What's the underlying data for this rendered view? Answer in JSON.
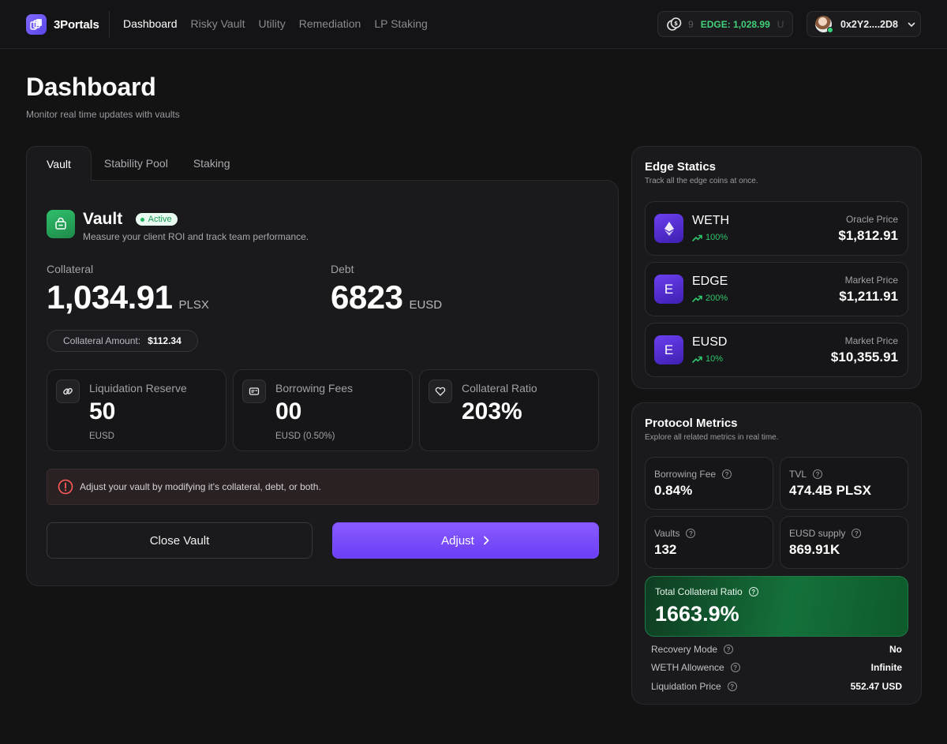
{
  "app": {
    "name": "3Portals"
  },
  "nav": {
    "items": [
      {
        "label": "Dashboard",
        "active": true
      },
      {
        "label": "Risky Vault",
        "active": false
      },
      {
        "label": "Utility",
        "active": false
      },
      {
        "label": "Remediation",
        "active": false
      },
      {
        "label": "LP Staking",
        "active": false
      }
    ]
  },
  "ticker": {
    "prefix": "9",
    "value": "EDGE: 1,028.99",
    "suffix": "U"
  },
  "wallet": {
    "address": "0x2Y2....2D8"
  },
  "page": {
    "title": "Dashboard",
    "subtitle": "Monitor real time updates with vaults"
  },
  "tabs": [
    {
      "label": "Vault",
      "active": true
    },
    {
      "label": "Stability Pool",
      "active": false
    },
    {
      "label": "Staking",
      "active": false
    }
  ],
  "vault": {
    "title": "Vault",
    "status": "Active",
    "description": "Measure your client ROI and track team performance.",
    "collateral": {
      "label": "Collateral",
      "value": "1,034.91",
      "unit": "PLSX"
    },
    "debt": {
      "label": "Debt",
      "value": "6823",
      "unit": "EUSD"
    },
    "collateral_amount": {
      "label": "Collateral Amount:",
      "value": "$112.34"
    },
    "cards": [
      {
        "label": "Liquidation Reserve",
        "value": "50",
        "sub": "EUSD",
        "icon": "link-icon"
      },
      {
        "label": "Borrowing Fees",
        "value": "00",
        "sub": "EUSD (0.50%)",
        "icon": "receipt-icon"
      },
      {
        "label": "Collateral Ratio",
        "value": "203%",
        "sub": "",
        "icon": "heart-icon"
      }
    ],
    "alert": "Adjust your vault by modifying it's collateral, debt, or both.",
    "close_label": "Close Vault",
    "adjust_label": "Adjust"
  },
  "edge_statics": {
    "title": "Edge Statics",
    "subtitle": "Track all the edge coins at once.",
    "coins": [
      {
        "name": "WETH",
        "change": "100%",
        "price_label": "Oracle Price",
        "price": "$1,812.91",
        "icon": "ethereum-icon"
      },
      {
        "name": "EDGE",
        "change": "200%",
        "price_label": "Market Price",
        "price": "$1,211.91",
        "icon_text": "E"
      },
      {
        "name": "EUSD",
        "change": "10%",
        "price_label": "Market Price",
        "price": "$10,355.91",
        "icon_text": "E"
      }
    ]
  },
  "protocol_metrics": {
    "title": "Protocol Metrics",
    "subtitle": "Explore all related metrics in real time.",
    "borrowing_fee": {
      "label": "Borrowing Fee",
      "value": "0.84%"
    },
    "tvl": {
      "label": "TVL",
      "value": "474.4B PLSX"
    },
    "vaults": {
      "label": "Vaults",
      "value": "132"
    },
    "eusd_supply": {
      "label": "EUSD supply",
      "value": "869.91K"
    },
    "total_collateral_ratio": {
      "label": "Total Collateral Ratio",
      "value": "1663.9%"
    },
    "rows": [
      {
        "label": "Recovery Mode",
        "value": "No"
      },
      {
        "label": "WETH Allowence",
        "value": "Infinite"
      },
      {
        "label": "Liquidation Price",
        "value": "552.47 USD"
      }
    ]
  },
  "colors": {
    "accent": "#7a4dff",
    "positive": "#2fc46b",
    "badge_bg": "#e9fbf0"
  }
}
